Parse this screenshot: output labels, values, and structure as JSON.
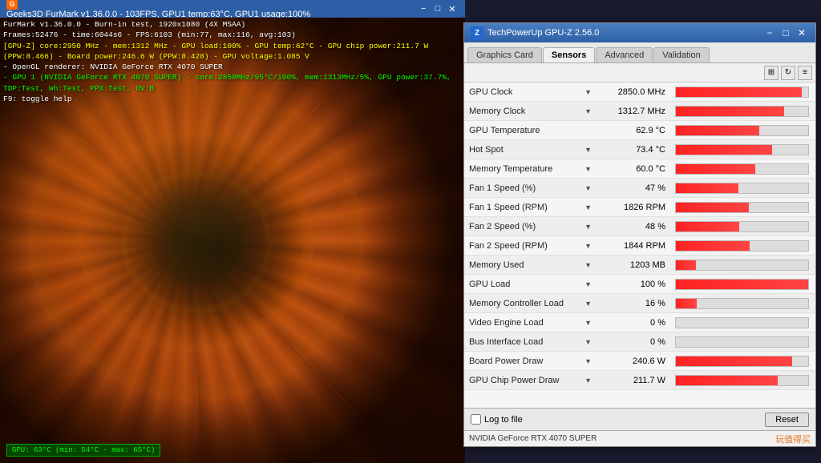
{
  "furmark": {
    "title": "Geeks3D FurMark v1.36.0.0 - 103FPS, GPU1 temp:63°C, GPU1 usage:100%",
    "icon": "G",
    "info_lines": [
      {
        "text": "FurMark v1.36.0.0 - Burn-in test, 1920x1080 (4X MSAA)",
        "class": "white"
      },
      {
        "text": "Frames:52476 - time:6044s6 - FPS:6103 (min:77, max:116, avg:103)",
        "class": "white"
      },
      {
        "text": "[GPU-Z] core:2950 MHz - mem:1312 MHz - GPU load:100% - GPU temp:62°C - GPU chip power:211.7 W (PPW:8.466) - Board power:246.6 W (PPW:8.428) - GPU voltage:1.085 V",
        "class": "yellow"
      },
      {
        "text": "- OpenGL renderer: NVIDIA GeForce RTX 4070 SUPER",
        "class": "white"
      },
      {
        "text": "- GPU 1 (NVIDIA GeForce RTX 4070 SUPER) - core:2850MHz/95°C/100%, mem:1313MHz/5%, GPU power:37.7%, TDP:Test, Wh:Test, PPX:Test, OV:B",
        "class": "green"
      },
      {
        "text": "F9: toggle help",
        "class": "white"
      }
    ],
    "temp_display": "GPU: 63°C (min: 54°C - max: 65°C)",
    "window_controls": [
      "−",
      "□",
      "✕"
    ]
  },
  "gpuz": {
    "title": "TechPowerUp GPU-Z 2.56.0",
    "icon": "Z",
    "tabs": [
      {
        "label": "Graphics Card",
        "active": false
      },
      {
        "label": "Sensors",
        "active": true
      },
      {
        "label": "Advanced",
        "active": false
      },
      {
        "label": "Validation",
        "active": false
      }
    ],
    "toolbar_icons": [
      "grid",
      "refresh",
      "menu"
    ],
    "sensors": [
      {
        "name": "GPU Clock",
        "value": "2850.0 MHz",
        "bar_pct": 95,
        "has_dropdown": true
      },
      {
        "name": "Memory Clock",
        "value": "1312.7 MHz",
        "bar_pct": 82,
        "has_dropdown": true
      },
      {
        "name": "GPU Temperature",
        "value": "62.9 °C",
        "bar_pct": 63,
        "has_dropdown": false
      },
      {
        "name": "Hot Spot",
        "value": "73.4 °C",
        "bar_pct": 73,
        "has_dropdown": true
      },
      {
        "name": "Memory Temperature",
        "value": "60.0 °C",
        "bar_pct": 60,
        "has_dropdown": true
      },
      {
        "name": "Fan 1 Speed (%)",
        "value": "47 %",
        "bar_pct": 47,
        "has_dropdown": true
      },
      {
        "name": "Fan 1 Speed (RPM)",
        "value": "1826 RPM",
        "bar_pct": 55,
        "has_dropdown": true
      },
      {
        "name": "Fan 2 Speed (%)",
        "value": "48 %",
        "bar_pct": 48,
        "has_dropdown": true
      },
      {
        "name": "Fan 2 Speed (RPM)",
        "value": "1844 RPM",
        "bar_pct": 56,
        "has_dropdown": true
      },
      {
        "name": "Memory Used",
        "value": "1203 MB",
        "bar_pct": 15,
        "has_dropdown": true
      },
      {
        "name": "GPU Load",
        "value": "100 %",
        "bar_pct": 100,
        "has_dropdown": true
      },
      {
        "name": "Memory Controller Load",
        "value": "16 %",
        "bar_pct": 16,
        "has_dropdown": true
      },
      {
        "name": "Video Engine Load",
        "value": "0 %",
        "bar_pct": 0,
        "has_dropdown": true
      },
      {
        "name": "Bus Interface Load",
        "value": "0 %",
        "bar_pct": 0,
        "has_dropdown": true
      },
      {
        "name": "Board Power Draw",
        "value": "240.6 W",
        "bar_pct": 88,
        "has_dropdown": true
      },
      {
        "name": "GPU Chip Power Draw",
        "value": "211.7 W",
        "bar_pct": 77,
        "has_dropdown": true
      }
    ],
    "footer": {
      "log_label": "Log to file",
      "reset_label": "Reset"
    },
    "statusbar": {
      "gpu_name": "NVIDIA GeForce RTX 4070 SUPER",
      "logo": "值得买"
    },
    "window_controls": [
      "−",
      "□",
      "✕"
    ]
  }
}
